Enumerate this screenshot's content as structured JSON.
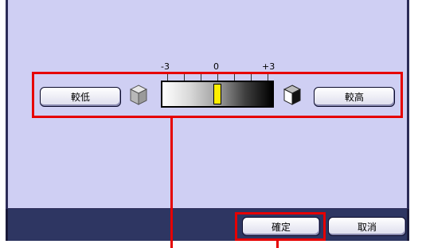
{
  "scale": {
    "labels": [
      "-3",
      "0",
      "+3"
    ],
    "level": 0,
    "min": -3,
    "max": 3
  },
  "buttons": {
    "lighter": "較低",
    "darker": "較高",
    "ok": "確定",
    "cancel": "取消"
  },
  "colors": {
    "panel": "#cfcff3",
    "bottom_bar": "#2e3662",
    "highlight": "#e60000",
    "marker": "#ffee00"
  },
  "icons": [
    "light-cube-icon",
    "dark-cube-icon"
  ]
}
